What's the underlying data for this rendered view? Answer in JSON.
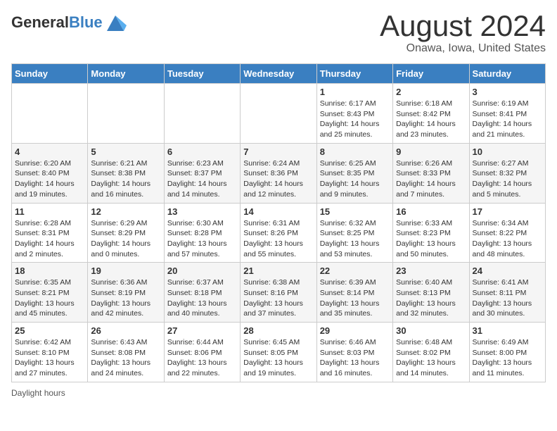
{
  "header": {
    "logo_general": "General",
    "logo_blue": "Blue",
    "month_year": "August 2024",
    "location": "Onawa, Iowa, United States"
  },
  "days_of_week": [
    "Sunday",
    "Monday",
    "Tuesday",
    "Wednesday",
    "Thursday",
    "Friday",
    "Saturday"
  ],
  "footer": {
    "label": "Daylight hours"
  },
  "weeks": [
    [
      {
        "day": "",
        "sunrise": "",
        "sunset": "",
        "daylight": ""
      },
      {
        "day": "",
        "sunrise": "",
        "sunset": "",
        "daylight": ""
      },
      {
        "day": "",
        "sunrise": "",
        "sunset": "",
        "daylight": ""
      },
      {
        "day": "",
        "sunrise": "",
        "sunset": "",
        "daylight": ""
      },
      {
        "day": "1",
        "sunrise": "Sunrise: 6:17 AM",
        "sunset": "Sunset: 8:43 PM",
        "daylight": "Daylight: 14 hours and 25 minutes."
      },
      {
        "day": "2",
        "sunrise": "Sunrise: 6:18 AM",
        "sunset": "Sunset: 8:42 PM",
        "daylight": "Daylight: 14 hours and 23 minutes."
      },
      {
        "day": "3",
        "sunrise": "Sunrise: 6:19 AM",
        "sunset": "Sunset: 8:41 PM",
        "daylight": "Daylight: 14 hours and 21 minutes."
      }
    ],
    [
      {
        "day": "4",
        "sunrise": "Sunrise: 6:20 AM",
        "sunset": "Sunset: 8:40 PM",
        "daylight": "Daylight: 14 hours and 19 minutes."
      },
      {
        "day": "5",
        "sunrise": "Sunrise: 6:21 AM",
        "sunset": "Sunset: 8:38 PM",
        "daylight": "Daylight: 14 hours and 16 minutes."
      },
      {
        "day": "6",
        "sunrise": "Sunrise: 6:23 AM",
        "sunset": "Sunset: 8:37 PM",
        "daylight": "Daylight: 14 hours and 14 minutes."
      },
      {
        "day": "7",
        "sunrise": "Sunrise: 6:24 AM",
        "sunset": "Sunset: 8:36 PM",
        "daylight": "Daylight: 14 hours and 12 minutes."
      },
      {
        "day": "8",
        "sunrise": "Sunrise: 6:25 AM",
        "sunset": "Sunset: 8:35 PM",
        "daylight": "Daylight: 14 hours and 9 minutes."
      },
      {
        "day": "9",
        "sunrise": "Sunrise: 6:26 AM",
        "sunset": "Sunset: 8:33 PM",
        "daylight": "Daylight: 14 hours and 7 minutes."
      },
      {
        "day": "10",
        "sunrise": "Sunrise: 6:27 AM",
        "sunset": "Sunset: 8:32 PM",
        "daylight": "Daylight: 14 hours and 5 minutes."
      }
    ],
    [
      {
        "day": "11",
        "sunrise": "Sunrise: 6:28 AM",
        "sunset": "Sunset: 8:31 PM",
        "daylight": "Daylight: 14 hours and 2 minutes."
      },
      {
        "day": "12",
        "sunrise": "Sunrise: 6:29 AM",
        "sunset": "Sunset: 8:29 PM",
        "daylight": "Daylight: 14 hours and 0 minutes."
      },
      {
        "day": "13",
        "sunrise": "Sunrise: 6:30 AM",
        "sunset": "Sunset: 8:28 PM",
        "daylight": "Daylight: 13 hours and 57 minutes."
      },
      {
        "day": "14",
        "sunrise": "Sunrise: 6:31 AM",
        "sunset": "Sunset: 8:26 PM",
        "daylight": "Daylight: 13 hours and 55 minutes."
      },
      {
        "day": "15",
        "sunrise": "Sunrise: 6:32 AM",
        "sunset": "Sunset: 8:25 PM",
        "daylight": "Daylight: 13 hours and 53 minutes."
      },
      {
        "day": "16",
        "sunrise": "Sunrise: 6:33 AM",
        "sunset": "Sunset: 8:23 PM",
        "daylight": "Daylight: 13 hours and 50 minutes."
      },
      {
        "day": "17",
        "sunrise": "Sunrise: 6:34 AM",
        "sunset": "Sunset: 8:22 PM",
        "daylight": "Daylight: 13 hours and 48 minutes."
      }
    ],
    [
      {
        "day": "18",
        "sunrise": "Sunrise: 6:35 AM",
        "sunset": "Sunset: 8:21 PM",
        "daylight": "Daylight: 13 hours and 45 minutes."
      },
      {
        "day": "19",
        "sunrise": "Sunrise: 6:36 AM",
        "sunset": "Sunset: 8:19 PM",
        "daylight": "Daylight: 13 hours and 42 minutes."
      },
      {
        "day": "20",
        "sunrise": "Sunrise: 6:37 AM",
        "sunset": "Sunset: 8:18 PM",
        "daylight": "Daylight: 13 hours and 40 minutes."
      },
      {
        "day": "21",
        "sunrise": "Sunrise: 6:38 AM",
        "sunset": "Sunset: 8:16 PM",
        "daylight": "Daylight: 13 hours and 37 minutes."
      },
      {
        "day": "22",
        "sunrise": "Sunrise: 6:39 AM",
        "sunset": "Sunset: 8:14 PM",
        "daylight": "Daylight: 13 hours and 35 minutes."
      },
      {
        "day": "23",
        "sunrise": "Sunrise: 6:40 AM",
        "sunset": "Sunset: 8:13 PM",
        "daylight": "Daylight: 13 hours and 32 minutes."
      },
      {
        "day": "24",
        "sunrise": "Sunrise: 6:41 AM",
        "sunset": "Sunset: 8:11 PM",
        "daylight": "Daylight: 13 hours and 30 minutes."
      }
    ],
    [
      {
        "day": "25",
        "sunrise": "Sunrise: 6:42 AM",
        "sunset": "Sunset: 8:10 PM",
        "daylight": "Daylight: 13 hours and 27 minutes."
      },
      {
        "day": "26",
        "sunrise": "Sunrise: 6:43 AM",
        "sunset": "Sunset: 8:08 PM",
        "daylight": "Daylight: 13 hours and 24 minutes."
      },
      {
        "day": "27",
        "sunrise": "Sunrise: 6:44 AM",
        "sunset": "Sunset: 8:06 PM",
        "daylight": "Daylight: 13 hours and 22 minutes."
      },
      {
        "day": "28",
        "sunrise": "Sunrise: 6:45 AM",
        "sunset": "Sunset: 8:05 PM",
        "daylight": "Daylight: 13 hours and 19 minutes."
      },
      {
        "day": "29",
        "sunrise": "Sunrise: 6:46 AM",
        "sunset": "Sunset: 8:03 PM",
        "daylight": "Daylight: 13 hours and 16 minutes."
      },
      {
        "day": "30",
        "sunrise": "Sunrise: 6:48 AM",
        "sunset": "Sunset: 8:02 PM",
        "daylight": "Daylight: 13 hours and 14 minutes."
      },
      {
        "day": "31",
        "sunrise": "Sunrise: 6:49 AM",
        "sunset": "Sunset: 8:00 PM",
        "daylight": "Daylight: 13 hours and 11 minutes."
      }
    ]
  ]
}
